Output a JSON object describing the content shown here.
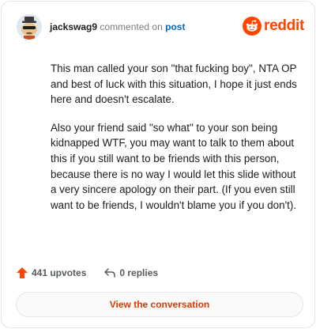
{
  "header": {
    "username": "jackswag9",
    "commented_text": "commented on",
    "post_link": "post",
    "logo_text": "reddit",
    "brand_color": "#ff4500"
  },
  "comment": {
    "paragraphs": [
      "This man called your son \"that fucking boy\", NTA OP and best of luck with this situation, I hope it just ends here and doesn't escalate.",
      "Also your friend said \"so what\" to your son being kidnapped WTF, you may want to talk to them about this if you still want to be friends with this person, because there is no way I would let this slide without a very sincere apology on their part. (If you even still want to be friends, I wouldn't blame you if you don't)."
    ]
  },
  "actions": {
    "upvotes": "441 upvotes",
    "replies": "0 replies",
    "upvote_icon": "upvote-arrow-icon",
    "reply_icon": "reply-icon"
  },
  "footer": {
    "view_label": "View the conversation"
  }
}
